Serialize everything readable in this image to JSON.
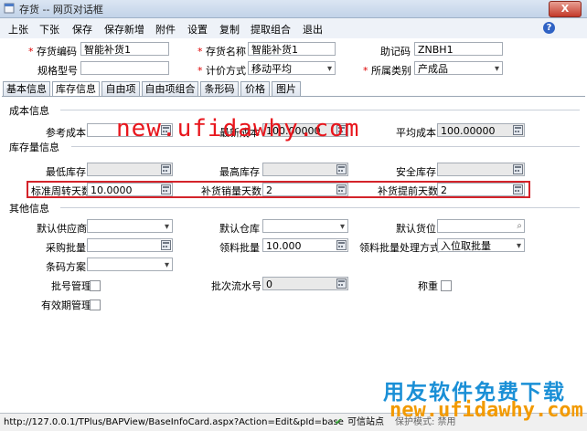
{
  "window": {
    "title": "存货 -- 网页对话框",
    "close_label": "X"
  },
  "toolbar": {
    "buttons": [
      "上张",
      "下张",
      "保存",
      "保存新增",
      "附件",
      "设置",
      "复制",
      "提取组合",
      "退出"
    ],
    "help": "?"
  },
  "header_form": {
    "code_label": "存货编码",
    "code_value": "智能补货1",
    "name_label": "存货名称",
    "name_value": "智能补货1",
    "mnemonic_label": "助记码",
    "mnemonic_value": "ZNBH1",
    "spec_label": "规格型号",
    "spec_value": "",
    "valuation_label": "计价方式",
    "valuation_value": "移动平均",
    "category_label": "所属类别",
    "category_value": "产成品"
  },
  "tabs": [
    "基本信息",
    "库存信息",
    "自由项",
    "自由项组合",
    "条形码",
    "价格",
    "图片"
  ],
  "active_tab": "库存信息",
  "cost_section": {
    "title": "成本信息",
    "ref_cost_label": "参考成本",
    "ref_cost_value": "",
    "latest_cost_label": "最新成本",
    "latest_cost_value": "100.00000",
    "avg_cost_label": "平均成本",
    "avg_cost_value": "100.00000"
  },
  "stock_section": {
    "title": "库存量信息",
    "min_label": "最低库存",
    "min_value": "",
    "max_label": "最高库存",
    "max_value": "",
    "safety_label": "安全库存",
    "safety_value": "",
    "turnover_label": "标准周转天数",
    "turnover_value": "10.0000",
    "sales_days_label": "补货销量天数",
    "sales_days_value": "2",
    "lead_days_label": "补货提前天数",
    "lead_days_value": "2"
  },
  "other_section": {
    "title": "其他信息",
    "supplier_label": "默认供应商",
    "supplier_value": "",
    "warehouse_label": "默认仓库",
    "warehouse_value": "",
    "location_label": "默认货位",
    "location_value": "",
    "purchase_batch_label": "采购批量",
    "purchase_batch_value": "",
    "issue_batch_label": "领料批量",
    "issue_batch_value": "10.000",
    "issue_method_label": "领料批量处理方式",
    "issue_method_value": "入位取批量",
    "barcode_label": "条码方案",
    "barcode_value": "",
    "batch_mgmt_label": "批号管理",
    "batch_serial_label": "批次流水号",
    "batch_serial_value": "0",
    "weigh_label": "称重",
    "expiry_label": "有效期管理"
  },
  "status_bar": {
    "url": "http://127.0.0.1/TPlus/BAPView/BaseInfoCard.aspx?Action=Edit&pId=base",
    "trusted": "可信站点",
    "mode": "保护模式: 禁用"
  },
  "watermarks": {
    "url": "new.ufidawhy.com",
    "cn": "用友软件免费下载",
    "url2": "new.ufidawhy.com"
  },
  "colors": {
    "highlight": "#d4232a",
    "watermark_red": "#e8161d",
    "watermark_blue": "#1a8fd6",
    "watermark_orange": "#f29a00"
  }
}
